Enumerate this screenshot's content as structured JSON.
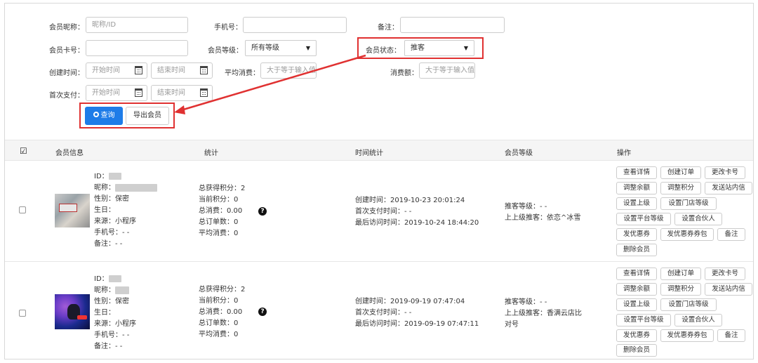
{
  "filters": {
    "nickname_label": "会员昵称：",
    "nickname_placeholder": "昵称/ID",
    "phone_label": "手机号：",
    "remark_label": "备注：",
    "card_label": "会员卡号：",
    "level_label": "会员等级：",
    "level_value": "所有等级",
    "status_label": "会员状态：",
    "status_value": "推客",
    "create_time_label": "创建时间：",
    "start_placeholder": "开始时间",
    "end_placeholder": "结束时间",
    "avg_label": "平均消费：",
    "avg_placeholder": "大于等于输入值",
    "total_label": "消费额：",
    "total_placeholder": "大于等于输入值",
    "first_pay_label": "首次支付：",
    "search_label": "查询",
    "export_label": "导出会员"
  },
  "table": {
    "headers": [
      "会员信息",
      "统计",
      "时间统计",
      "会员等级",
      "操作"
    ],
    "rows": [
      {
        "info": [
          "ID：",
          "昵称：",
          "性别：保密",
          "生日：",
          "来源：小程序",
          "手机号：- -",
          "备注：- -"
        ],
        "stats": [
          "总获得积分：2",
          "当前积分：0",
          "总消费：0.00",
          "总订单数：0",
          "平均消费：0"
        ],
        "times": [
          "创建时间：2019-10-23 20:01:24",
          "首次支付时间：- -",
          "最后访问时间：2019-10-24 18:44:20"
        ],
        "level": [
          "推客等级：- -",
          "上上级推客：依恋^冰雪"
        ]
      },
      {
        "info": [
          "ID：",
          "昵称：",
          "性别：保密",
          "生日：",
          "来源：小程序",
          "手机号：- -",
          "备注：- -"
        ],
        "stats": [
          "总获得积分：2",
          "当前积分：0",
          "总消费：0.00",
          "总订单数：0",
          "平均消费：0"
        ],
        "times": [
          "创建时间：2019-09-19 07:47:04",
          "首次支付时间：- -",
          "最后访问时间：2019-09-19 07:47:11"
        ],
        "level": [
          "推客等级：- -",
          "上上级推客：香满云店比",
          "对号"
        ]
      }
    ],
    "ops": [
      "查看详情",
      "创建订单",
      "更改卡号",
      "调整余额",
      "调整积分",
      "发送站内信",
      "设置上级",
      "设置门店等级",
      "设置平台等级",
      "设置合伙人",
      "发优惠券",
      "发优惠券券包",
      "备注",
      "删除会员"
    ],
    "help_icon": "?"
  },
  "colors": {
    "primary": "#1e7ce8",
    "highlight": "#e03131"
  }
}
